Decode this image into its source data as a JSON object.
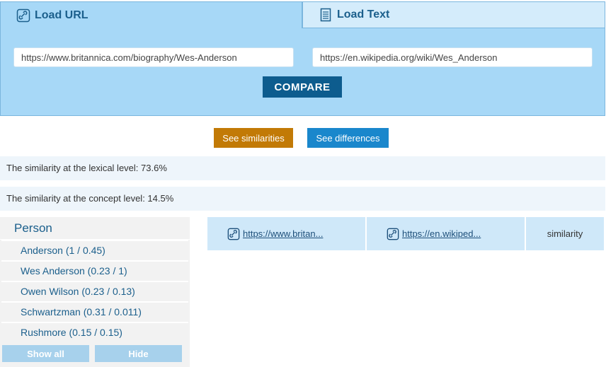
{
  "tabs": {
    "load_url": "Load URL",
    "load_text": "Load Text"
  },
  "inputs": {
    "url_left": "https://www.britannica.com/biography/Wes-Anderson",
    "url_right": "https://en.wikipedia.org/wiki/Wes_Anderson"
  },
  "buttons": {
    "compare": "COMPARE",
    "see_similarities": "See similarities",
    "see_differences": "See differences",
    "show_all": "Show all",
    "hide": "Hide"
  },
  "similarity": {
    "lexical": "The similarity at the lexical level: 73.6%",
    "concept": "The similarity at the concept level: 14.5%"
  },
  "person": {
    "title": "Person",
    "items": [
      {
        "label": "Anderson (1 / 0.45)"
      },
      {
        "label": "Wes Anderson (0.23 / 1)"
      },
      {
        "label": "Owen Wilson (0.23 / 0.13)"
      },
      {
        "label": "Schwartzman (0.31 / 0.011)"
      },
      {
        "label": "Rushmore (0.15 / 0.15)"
      }
    ]
  },
  "results": {
    "col1": "https://www.britan...",
    "col2": "https://en.wikiped...",
    "col3": "similarity"
  },
  "colors": {
    "tab_active": "#a7d8f7",
    "tab_inactive": "#d4ecfb",
    "compare": "#0d5c8e",
    "similarities": "#c27a06",
    "differences": "#1a87cc"
  }
}
